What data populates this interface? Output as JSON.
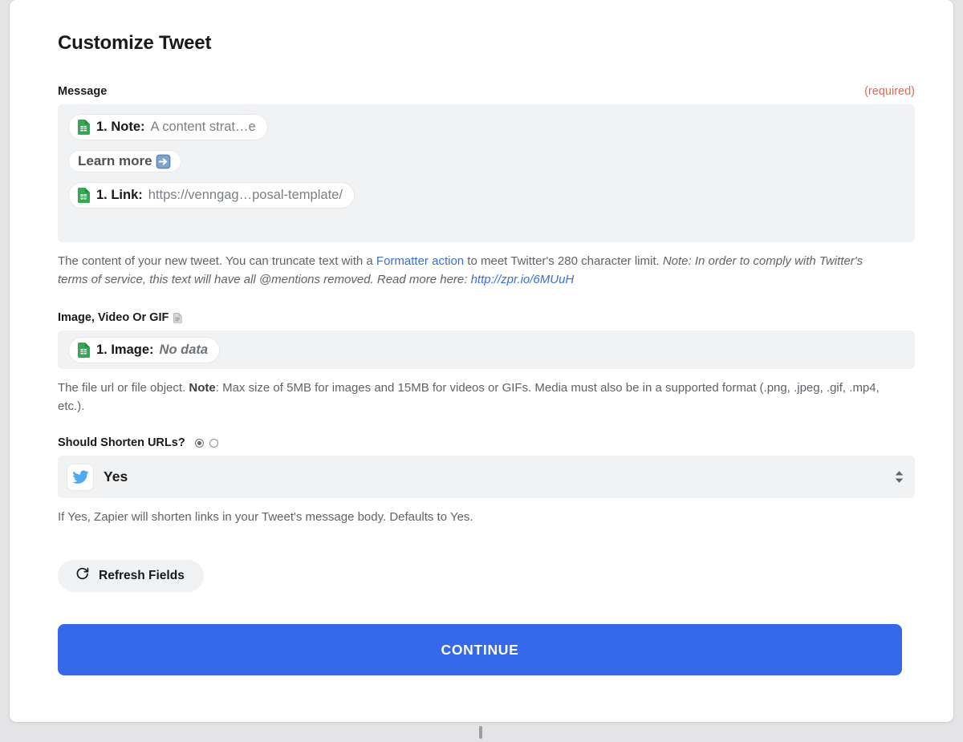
{
  "page": {
    "title": "Customize Tweet"
  },
  "message_field": {
    "label": "Message",
    "required_label": "(required)",
    "tokens": [
      {
        "icon": "google-sheets-icon",
        "key": "1. Note:",
        "value": "A content strat…e"
      },
      {
        "icon": "arrow-right-emoji",
        "text": "Learn more"
      },
      {
        "icon": "google-sheets-icon",
        "key": "1. Link:",
        "value": "https://venngag…posal-template/"
      }
    ],
    "help": {
      "part1": "The content of your new tweet. You can truncate text with a ",
      "link1": "Formatter action",
      "part2": " to meet Twitter's 280 character limit. ",
      "italic1": "Note: In order to comply with Twitter's terms of service, this text will have all @mentions removed. Read more here: ",
      "link2": "http://zpr.io/6MUuH"
    }
  },
  "image_field": {
    "label": "Image, Video Or GIF",
    "label_icon": "document-icon",
    "token": {
      "icon": "google-sheets-icon",
      "key": "1. Image:",
      "value": "No data"
    },
    "help": {
      "part1": "The file url or file object. ",
      "bold1": "Note",
      "part2": ": Max size of 5MB for images and 15MB for videos or GIFs. Media must also be in a supported format (.png, .jpeg, .gif, .mp4, etc.)."
    }
  },
  "shorten_field": {
    "label": "Should Shorten URLs?",
    "radio_options": [
      {
        "name": "radio-selected",
        "selected": true
      },
      {
        "name": "radio-unselected",
        "selected": false
      }
    ],
    "selected_value": "Yes",
    "value_icon": "twitter-icon",
    "stepper_icon": "stepper-up-down-icon",
    "help": "If Yes, Zapier will shorten links in your Tweet's message body. Defaults to Yes."
  },
  "actions": {
    "refresh_label": "Refresh Fields",
    "refresh_icon": "refresh-icon",
    "continue_label": "CONTINUE"
  },
  "colors": {
    "accent_blue": "#3669e9",
    "required_red": "#e06950",
    "link_blue": "#3a6fd8",
    "field_bg": "#f1f2f3",
    "page_bg": "#e4e4e6"
  }
}
